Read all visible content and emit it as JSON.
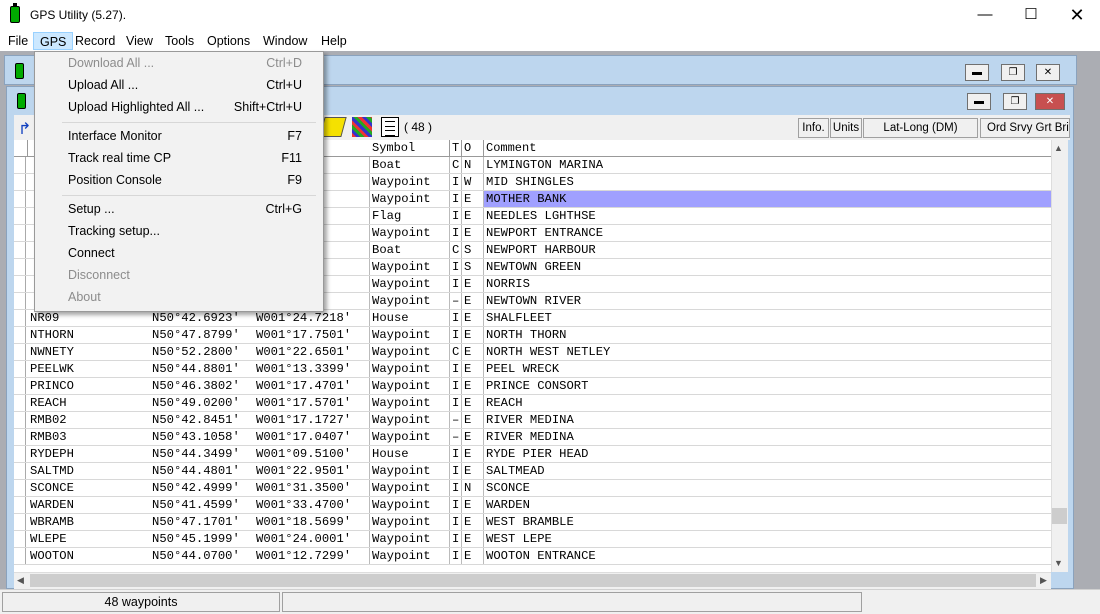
{
  "window": {
    "title": "GPS Utility (5.27)."
  },
  "menubar": [
    "File",
    "GPS",
    "Record",
    "View",
    "Tools",
    "Options",
    "Window",
    "Help"
  ],
  "gps_menu": [
    {
      "label": "Download All ...",
      "shortcut": "Ctrl+D",
      "enabled": false
    },
    {
      "label": "Upload All ...",
      "shortcut": "Ctrl+U",
      "enabled": true
    },
    {
      "label": "Upload Highlighted All ...",
      "shortcut": "Shift+Ctrl+U",
      "enabled": true
    },
    {
      "label": "Interface Monitor",
      "shortcut": "F7",
      "enabled": true
    },
    {
      "label": "Track real time CP",
      "shortcut": "F11",
      "enabled": true
    },
    {
      "label": "Position Console",
      "shortcut": "F9",
      "enabled": true
    },
    {
      "label": "Setup ...",
      "shortcut": "Ctrl+G",
      "enabled": true
    },
    {
      "label": "Tracking setup...",
      "shortcut": "",
      "enabled": true
    },
    {
      "label": "Connect",
      "shortcut": "",
      "enabled": true
    },
    {
      "label": "Disconnect",
      "shortcut": "",
      "enabled": false
    },
    {
      "label": "About",
      "shortcut": "",
      "enabled": false
    }
  ],
  "toolbar": {
    "count": "( 48 )",
    "info": "Info.",
    "units": "Units",
    "latlong": "Lat-Long (DM)",
    "datum": "Ord Srvy Grt Britn"
  },
  "grid": {
    "headers": {
      "symbol": "Symbol",
      "t": "T",
      "o": "O",
      "comment": "Comment"
    },
    "rows": [
      {
        "name": "",
        "lat": "",
        "lon": "7201'",
        "sym": "Boat",
        "t": "C",
        "o": "N",
        "comment": "LYMINGTON MARINA"
      },
      {
        "name": "",
        "lat": "",
        "lon": "5799'",
        "sym": "Waypoint",
        "t": "I",
        "o": "W",
        "comment": "MID SHINGLES"
      },
      {
        "name": "",
        "lat": "",
        "lon": "1300'",
        "sym": "Waypoint",
        "t": "I",
        "o": "E",
        "comment": "MOTHER BANK",
        "selected": true
      },
      {
        "name": "",
        "lat": "",
        "lon": "4301'",
        "sym": "Flag",
        "t": "I",
        "o": "E",
        "comment": "NEEDLES LGHTHSE"
      },
      {
        "name": "",
        "lat": "",
        "lon": "2999'",
        "sym": "Waypoint",
        "t": "I",
        "o": "E",
        "comment": "NEWPORT ENTRANCE"
      },
      {
        "name": "",
        "lat": "",
        "lon": "8302'",
        "sym": "Boat",
        "t": "C",
        "o": "S",
        "comment": "NEWPORT HARBOUR"
      },
      {
        "name": "",
        "lat": "",
        "lon": "5700'",
        "sym": "Waypoint",
        "t": "I",
        "o": "S",
        "comment": "NEWTOWN GREEN"
      },
      {
        "name": "",
        "lat": "",
        "lon": "4000'",
        "sym": "Waypoint",
        "t": "I",
        "o": "E",
        "comment": "NORRIS"
      },
      {
        "name": "",
        "lat": "",
        "lon": "8866'",
        "sym": "Waypoint",
        "t": "–",
        "o": "E",
        "comment": "NEWTOWN RIVER"
      },
      {
        "name": "NR09",
        "lat": "N50°42.6923'",
        "lon": "W001°24.7218'",
        "sym": "House",
        "t": "I",
        "o": "E",
        "comment": "SHALFLEET"
      },
      {
        "name": "NTHORN",
        "lat": "N50°47.8799'",
        "lon": "W001°17.7501'",
        "sym": "Waypoint",
        "t": "I",
        "o": "E",
        "comment": "NORTH THORN"
      },
      {
        "name": "NWNETY",
        "lat": "N50°52.2800'",
        "lon": "W001°22.6501'",
        "sym": "Waypoint",
        "t": "C",
        "o": "E",
        "comment": "NORTH WEST NETLEY"
      },
      {
        "name": "PEELWK",
        "lat": "N50°44.8801'",
        "lon": "W001°13.3399'",
        "sym": "Waypoint",
        "t": "I",
        "o": "E",
        "comment": "PEEL WRECK"
      },
      {
        "name": "PRINCO",
        "lat": "N50°46.3802'",
        "lon": "W001°17.4701'",
        "sym": "Waypoint",
        "t": "I",
        "o": "E",
        "comment": "PRINCE CONSORT"
      },
      {
        "name": "REACH",
        "lat": "N50°49.0200'",
        "lon": "W001°17.5701'",
        "sym": "Waypoint",
        "t": "I",
        "o": "E",
        "comment": "REACH"
      },
      {
        "name": "RMB02",
        "lat": "N50°42.8451'",
        "lon": "W001°17.1727'",
        "sym": "Waypoint",
        "t": "–",
        "o": "E",
        "comment": "RIVER MEDINA"
      },
      {
        "name": "RMB03",
        "lat": "N50°43.1058'",
        "lon": "W001°17.0407'",
        "sym": "Waypoint",
        "t": "–",
        "o": "E",
        "comment": "RIVER MEDINA"
      },
      {
        "name": "RYDEPH",
        "lat": "N50°44.3499'",
        "lon": "W001°09.5100'",
        "sym": "House",
        "t": "I",
        "o": "E",
        "comment": "RYDE PIER HEAD"
      },
      {
        "name": "SALTMD",
        "lat": "N50°44.4801'",
        "lon": "W001°22.9501'",
        "sym": "Waypoint",
        "t": "I",
        "o": "E",
        "comment": "SALTMEAD"
      },
      {
        "name": "SCONCE",
        "lat": "N50°42.4999'",
        "lon": "W001°31.3500'",
        "sym": "Waypoint",
        "t": "I",
        "o": "N",
        "comment": "SCONCE"
      },
      {
        "name": "WARDEN",
        "lat": "N50°41.4599'",
        "lon": "W001°33.4700'",
        "sym": "Waypoint",
        "t": "I",
        "o": "E",
        "comment": "WARDEN"
      },
      {
        "name": "WBRAMB",
        "lat": "N50°47.1701'",
        "lon": "W001°18.5699'",
        "sym": "Waypoint",
        "t": "I",
        "o": "E",
        "comment": "WEST BRAMBLE"
      },
      {
        "name": "WLEPE",
        "lat": "N50°45.1999'",
        "lon": "W001°24.0001'",
        "sym": "Waypoint",
        "t": "I",
        "o": "E",
        "comment": "WEST LEPE"
      },
      {
        "name": "WOOTON",
        "lat": "N50°44.0700'",
        "lon": "W001°12.7299'",
        "sym": "Waypoint",
        "t": "I",
        "o": "E",
        "comment": "WOOTON ENTRANCE"
      }
    ]
  },
  "status": {
    "waypoints": "48 waypoints"
  },
  "colors": {
    "selection": "#a0a0ff",
    "menu_highlight": "#cce8ff",
    "mdi_caption": "#bdd6ee"
  }
}
